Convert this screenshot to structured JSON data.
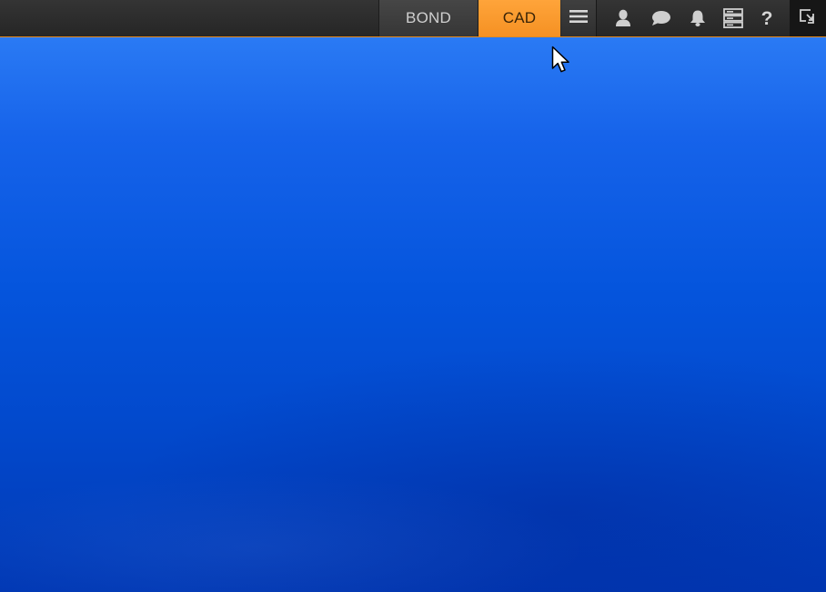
{
  "taskbar": {
    "tabs": [
      {
        "label": "BOND",
        "active": false
      },
      {
        "label": "CAD",
        "active": true
      }
    ],
    "accent_color": "#f7982a",
    "icons": {
      "menu": "hamburger-menu-icon",
      "user": "user-icon",
      "chat": "chat-bubble-icon",
      "notifications": "bell-icon",
      "servers": "server-list-icon",
      "help": "?",
      "restore": "restore-window-icon"
    }
  },
  "desktop": {
    "background_color": "#0a4fd8"
  }
}
